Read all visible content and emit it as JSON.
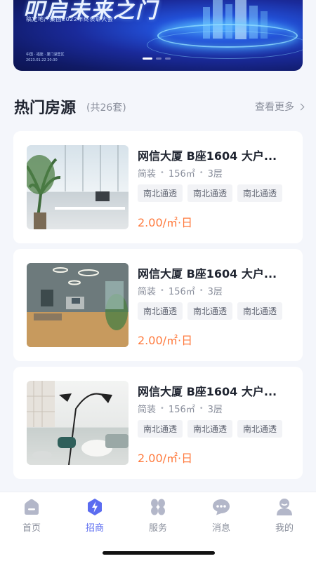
{
  "banner": {
    "title": "叩启未来之门",
    "subtitle": "稿定地产集团2022年终表彰大会",
    "meta_line1": "中国 · 福建 · 厦门湖里区",
    "meta_line2": "2023.01.22  20:30",
    "pager": {
      "count": 3,
      "active": 0
    }
  },
  "section": {
    "title": "热门房源",
    "count": "(共26套)",
    "more": "查看更多"
  },
  "listings": [
    {
      "title": "网信大厦 B座1604 大户...",
      "style": "简装",
      "area": "156㎡",
      "floor": "3层",
      "tags": [
        "南北通透",
        "南北通透",
        "南北通透"
      ],
      "price": "2.00/㎡·日"
    },
    {
      "title": "网信大厦 B座1604 大户...",
      "style": "简装",
      "area": "156㎡",
      "floor": "3层",
      "tags": [
        "南北通透",
        "南北通透",
        "南北通透"
      ],
      "price": "2.00/㎡·日"
    },
    {
      "title": "网信大厦 B座1604 大户...",
      "style": "简装",
      "area": "156㎡",
      "floor": "3层",
      "tags": [
        "南北通透",
        "南北通透",
        "南北通透"
      ],
      "price": "2.00/㎡·日"
    }
  ],
  "tabs": [
    {
      "label": "首页",
      "icon": "home-icon",
      "active": false
    },
    {
      "label": "招商",
      "icon": "lightning-icon",
      "active": true
    },
    {
      "label": "服务",
      "icon": "grid-icon",
      "active": false
    },
    {
      "label": "消息",
      "icon": "chat-icon",
      "active": false
    },
    {
      "label": "我的",
      "icon": "user-icon",
      "active": false
    }
  ],
  "colors": {
    "accent": "#5b6cf0",
    "price": "#ff7a3d",
    "muted": "#8a8f9c",
    "inactive_icon": "#b3b7c9"
  }
}
